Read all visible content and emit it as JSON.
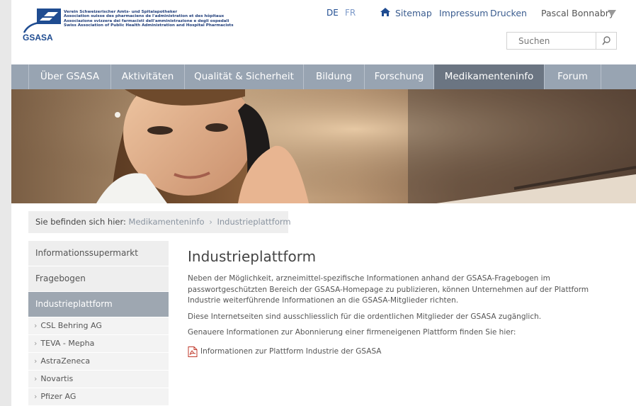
{
  "header": {
    "logo_lines": [
      "Verein Schweizerischer Amts- und Spitalapotheker",
      "Association suisse des pharmaciens de l'administration et des hôpitaux",
      "Associazione svizzera dei farmacisti dell'amministrazione e degli ospedali",
      "Swiss Association of Public Health Administration and Hospital Pharmacists"
    ],
    "logo_acronym": "GSASA",
    "lang_de": "DE",
    "lang_fr": "FR",
    "sitemap": "Sitemap",
    "impressum": "Impressum",
    "drucken": "Drucken",
    "user": "Pascal Bonnabry",
    "search_placeholder": "Suchen"
  },
  "nav": [
    {
      "label": "Über GSASA",
      "active": false
    },
    {
      "label": "Aktivitäten",
      "active": false
    },
    {
      "label": "Qualität & Sicherheit",
      "active": false
    },
    {
      "label": "Bildung",
      "active": false
    },
    {
      "label": "Forschung",
      "active": false
    },
    {
      "label": "Medikamenteninfo",
      "active": true
    },
    {
      "label": "Forum",
      "active": false
    }
  ],
  "breadcrumb": {
    "label": "Sie befinden sich hier:",
    "items": [
      "Medikamenteninfo",
      "Industrieplattform"
    ],
    "separator": "›"
  },
  "sidebar": {
    "top_items": [
      "Informationssupermarkt",
      "Fragebogen",
      "Industrieplattform"
    ],
    "active": "Industrieplattform",
    "sub_items": [
      "CSL Behring AG",
      "TEVA - Mepha",
      "AstraZeneca",
      "Novartis",
      "Pfizer AG"
    ],
    "sub_chevron": "›"
  },
  "main": {
    "title": "Industrieplattform",
    "paragraph1": "Neben der Möglichkeit, arzneimittel-spezifische Informationen anhand der GSASA-Fragebogen im passwortgeschützten Bereich der GSASA-Homepage zu publizieren, können Unternehmen auf der Plattform Industrie weiterführende Informationen an die GSASA-Mitglieder richten.",
    "paragraph2": "Diese Internetseiten sind ausschliesslich für die ordentlichen Mitglieder der GSASA zugänglich.",
    "paragraph3": "Genauere Informationen zur Abonnierung einer firmeneigenen Plattform finden Sie hier:",
    "pdf_link": "Informationen zur Plattform Industrie der GSASA"
  },
  "colors": {
    "nav_bg": "#98a4b2",
    "nav_active": "#6b7582",
    "sidebar_active": "#9ea7b1",
    "brand_blue": "#1f4c91"
  },
  "icons": {
    "home": "home-icon",
    "search": "search-icon",
    "user_menu": "caret-down-icon",
    "pdf": "pdf-icon"
  }
}
